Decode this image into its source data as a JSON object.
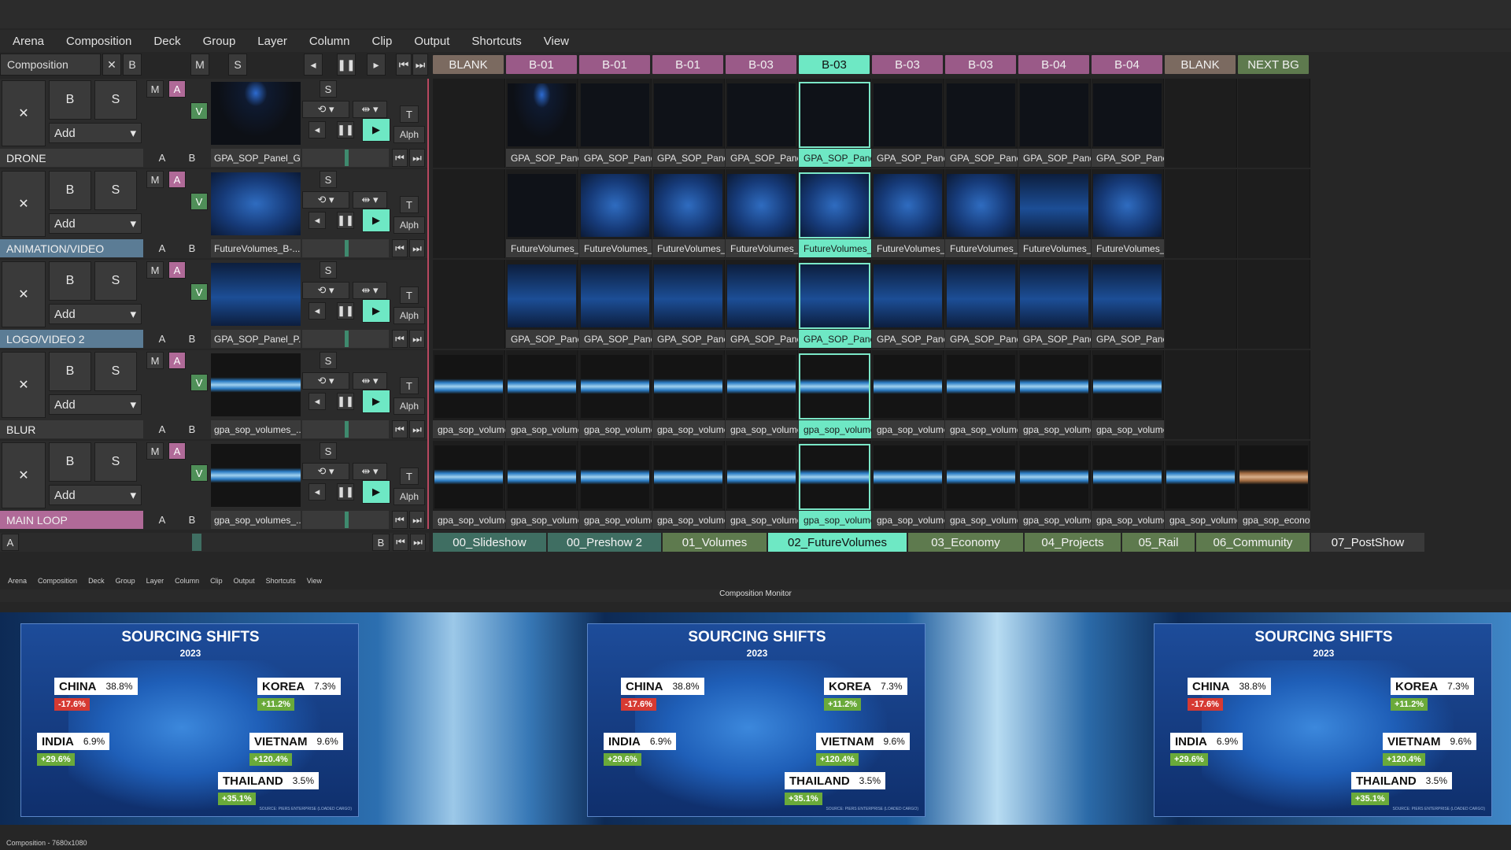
{
  "menu": [
    "Arena",
    "Composition",
    "Deck",
    "Group",
    "Layer",
    "Column",
    "Clip",
    "Output",
    "Shortcuts",
    "View"
  ],
  "composition": {
    "label": "Composition",
    "close": "✕",
    "b": "B",
    "m": "M",
    "s": "S"
  },
  "columns": [
    {
      "label": "BLANK",
      "color": "#7b6a60"
    },
    {
      "label": "B-01",
      "color": "#9a5a88"
    },
    {
      "label": "B-01",
      "color": "#9a5a88"
    },
    {
      "label": "B-01",
      "color": "#9a5a88"
    },
    {
      "label": "B-03",
      "color": "#9a5a88"
    },
    {
      "label": "B-03",
      "color": "#6ee8c4",
      "selected": true
    },
    {
      "label": "B-03",
      "color": "#9a5a88"
    },
    {
      "label": "B-03",
      "color": "#9a5a88"
    },
    {
      "label": "B-04",
      "color": "#9a5a88"
    },
    {
      "label": "B-04",
      "color": "#9a5a88"
    },
    {
      "label": "BLANK",
      "color": "#7b6a60"
    },
    {
      "label": "NEXT BG",
      "color": "#5e7a4e"
    }
  ],
  "controls": {
    "close": "✕",
    "b": "B",
    "s": "S",
    "add": "Add",
    "m": "M",
    "a": "A",
    "v": "V",
    "t": "T",
    "alph": "Alph",
    "ab_a": "A",
    "ab_b": "B"
  },
  "layers": [
    {
      "name": "DRONE",
      "name_bg": "#3a3a3a",
      "clip": "GPA_SOP_Panel_G...",
      "thumb": "drone",
      "cells": [
        "",
        "GPA_SOP_Panel_G...",
        "GPA_SOP_Panel_G...",
        "GPA_SOP_Panel_G...",
        "GPA_SOP_Panel_G...",
        "GPA_SOP_Panel_G...",
        "GPA_SOP_Panel_G...",
        "GPA_SOP_Panel_G...",
        "GPA_SOP_Panel_G...",
        "GPA_SOP_Panel_G...",
        "",
        ""
      ],
      "cell_style": [
        "",
        "drone",
        "dark",
        "dark",
        "dark",
        "dark",
        "dark",
        "dark",
        "dark",
        "dark",
        "",
        ""
      ]
    },
    {
      "name": "ANIMATION/VIDEO",
      "name_bg": "#5b7c95",
      "clip": "FutureVolumes_B-...",
      "thumb": "map",
      "cells": [
        "",
        "FutureVolumes_B-...",
        "FutureVolumes_B-...",
        "FutureVolumes_B-...",
        "FutureVolumes_B-...",
        "FutureVolumes_B-...",
        "FutureVolumes_B-...",
        "FutureVolumes_B-...",
        "FutureVolumes_B-...",
        "FutureVolumes_B-...",
        "",
        ""
      ],
      "cell_style": [
        "",
        "dark",
        "map",
        "map",
        "map",
        "map",
        "map",
        "map",
        "logo",
        "map",
        "",
        ""
      ]
    },
    {
      "name": "LOGO/VIDEO 2",
      "name_bg": "#5b7c95",
      "clip": "GPA_SOP_Panel_P...",
      "thumb": "logo",
      "cells": [
        "",
        "GPA_SOP_Panel_P...",
        "GPA_SOP_Panel_P...",
        "GPA_SOP_Panel_P...",
        "GPA_SOP_Panel_P...",
        "GPA_SOP_Panel_P...",
        "GPA_SOP_Panel_P...",
        "GPA_SOP_Panel_P...",
        "GPA_SOP_Panel_P...",
        "GPA_SOP_Panel_P...",
        "",
        ""
      ],
      "cell_style": [
        "",
        "logo",
        "logo",
        "logo",
        "logo",
        "logo",
        "logo",
        "logo",
        "logo",
        "logo",
        "",
        ""
      ]
    },
    {
      "name": "BLUR",
      "name_bg": "#3a3a3a",
      "clip": "gpa_sop_volumes_...",
      "thumb": "band",
      "cells": [
        "gpa_sop_volumes...",
        "gpa_sop_volumes...",
        "gpa_sop_volumes...",
        "gpa_sop_volumes...",
        "gpa_sop_volumes...",
        "gpa_sop_volumes...",
        "gpa_sop_volumes...",
        "gpa_sop_volumes...",
        "gpa_sop_volumes...",
        "gpa_sop_volumes...",
        "",
        ""
      ],
      "cell_style": [
        "band",
        "band",
        "band",
        "band",
        "band",
        "band",
        "band",
        "band",
        "band",
        "band",
        "",
        ""
      ]
    },
    {
      "name": "MAIN LOOP",
      "name_bg": "#b06a98",
      "clip": "gpa_sop_volumes_...",
      "thumb": "band",
      "cells": [
        "gpa_sop_volumes...",
        "gpa_sop_volumes...",
        "gpa_sop_volumes...",
        "gpa_sop_volumes...",
        "gpa_sop_volumes...",
        "gpa_sop_volumes...",
        "gpa_sop_volumes...",
        "gpa_sop_volumes...",
        "gpa_sop_volumes...",
        "gpa_sop_volumes...",
        "gpa_sop_volumes...",
        "gpa_sop_economi..."
      ],
      "cell_style": [
        "band",
        "band",
        "band",
        "band",
        "band",
        "band",
        "band",
        "band",
        "band",
        "band",
        "band",
        "rust"
      ]
    }
  ],
  "bottom_controls": {
    "a": "A",
    "b": "B"
  },
  "scenes": [
    {
      "label": "00_Slideshow",
      "color": "#3f6e62"
    },
    {
      "label": "00_Preshow 2",
      "color": "#3f6e62"
    },
    {
      "label": "01_Volumes",
      "color": "#5e7a4e"
    },
    {
      "label": "02_FutureVolumes",
      "color": "#6ee8c4",
      "selected": true
    },
    {
      "label": "03_Economy",
      "color": "#5e7a4e"
    },
    {
      "label": "04_Projects",
      "color": "#5e7a4e"
    },
    {
      "label": "05_Rail",
      "color": "#5e7a4e"
    },
    {
      "label": "06_Community",
      "color": "#5e7a4e"
    },
    {
      "label": "07_PostShow",
      "color": "#3a3a3a"
    }
  ],
  "menu2": [
    "Arena",
    "Composition",
    "Deck",
    "Group",
    "Layer",
    "Column",
    "Clip",
    "Output",
    "Shortcuts",
    "View"
  ],
  "monitor": {
    "header": "Composition Monitor",
    "panel": {
      "title": "SOURCING SHIFTS",
      "year": "2023",
      "source": "SOURCE: PIERS ENTERPRISE (LOADED CARGO)",
      "countries": [
        {
          "name": "CHINA",
          "pct": "38.8%",
          "chg": "-17.6%",
          "neg": true
        },
        {
          "name": "KOREA",
          "pct": "7.3%",
          "chg": "+11.2%",
          "neg": false
        },
        {
          "name": "INDIA",
          "pct": "6.9%",
          "chg": "+29.6%",
          "neg": false
        },
        {
          "name": "VIETNAM",
          "pct": "9.6%",
          "chg": "+120.4%",
          "neg": false
        },
        {
          "name": "THAILAND",
          "pct": "3.5%",
          "chg": "+35.1%",
          "neg": false
        }
      ]
    }
  },
  "status": "Composition - 7680x1080"
}
